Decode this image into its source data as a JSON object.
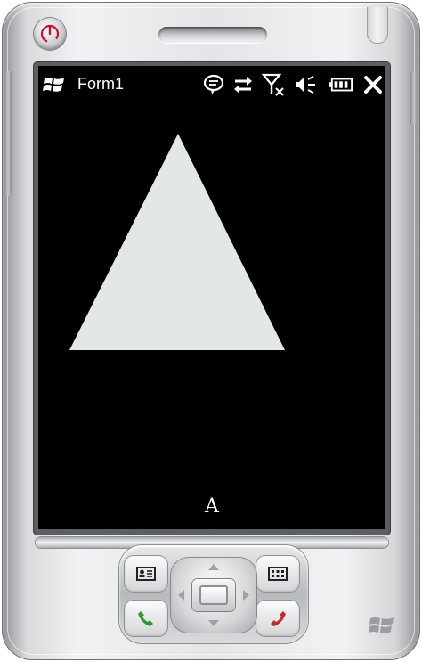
{
  "window": {
    "title": "Form1"
  },
  "taskbar": {
    "start_icon": "windows-flag-icon",
    "tray_icons": [
      "chat-bubble-icon",
      "sync-arrows-icon",
      "signal-off-icon",
      "volume-mute-icon",
      "battery-icon",
      "close-icon"
    ]
  },
  "form": {
    "label_text": "A",
    "triangle_color": "#e3e8e6",
    "background_color": "#000000"
  },
  "device": {
    "power_icon": "power-icon",
    "left_softkey_icon": "contact-card-icon",
    "right_softkey_icon": "grid-menu-icon",
    "call_icon": "phone-call-icon",
    "end_icon": "phone-end-icon",
    "accent_power": "#c8102e",
    "accent_call": "#2e9a2e",
    "accent_end": "#c82828"
  }
}
